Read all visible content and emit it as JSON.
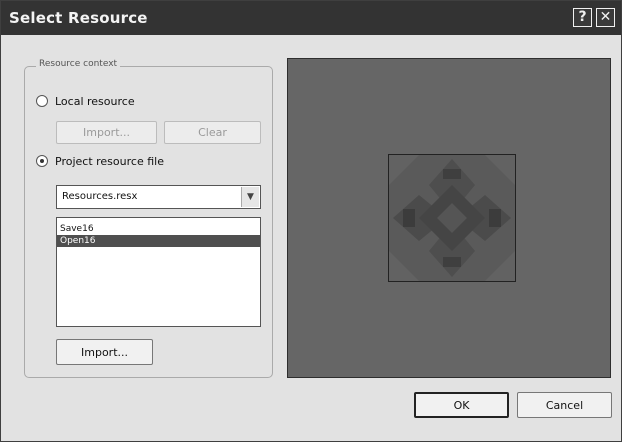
{
  "window": {
    "title": "Select Resource",
    "help_glyph": "?",
    "close_glyph": "✕"
  },
  "resource_context": {
    "group_label": "Resource context",
    "option_local": {
      "label": "Local resource",
      "checked": false
    },
    "import_button": "Import...",
    "clear_button": "Clear",
    "option_project": {
      "label": "Project resource file",
      "checked": true
    },
    "resource_file": "Resources.resx",
    "list_items": [
      {
        "label": "Save16",
        "selected": false
      },
      {
        "label": "Open16",
        "selected": true
      }
    ],
    "import_button_2": "Import..."
  },
  "preview": {
    "icon": "image-preview-icon"
  },
  "footer": {
    "ok_label": "OK",
    "cancel_label": "Cancel"
  },
  "colors": {
    "titlebar": "#333333",
    "dialog_bg": "#e2e2e2",
    "preview_bg": "#666666",
    "selection": "#4f4f4f"
  }
}
